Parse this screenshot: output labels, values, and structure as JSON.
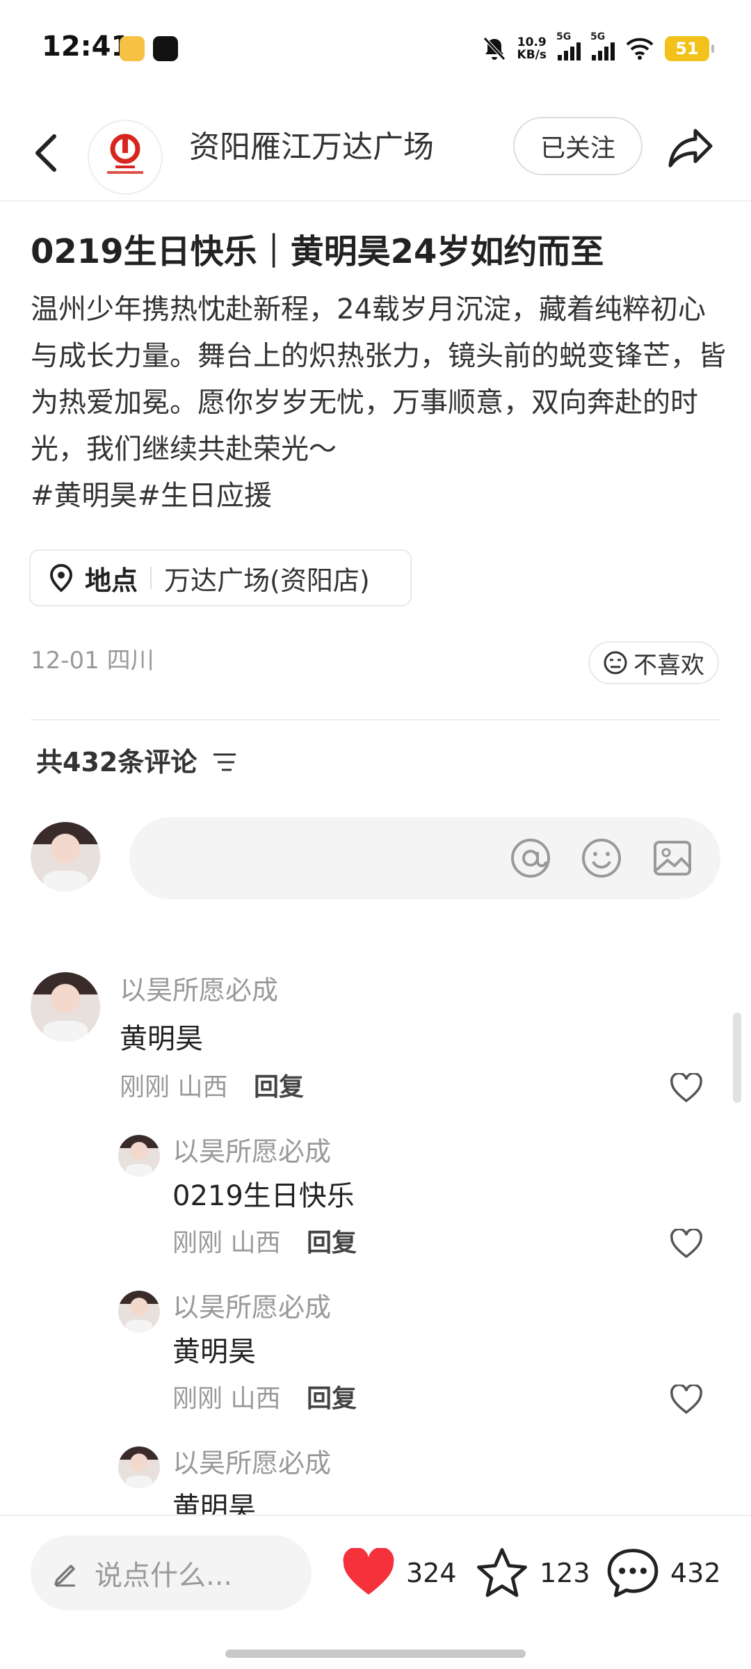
{
  "status_bar": {
    "time": "12:41",
    "speed_value": "10.9",
    "speed_unit": "KB/s",
    "network_1": "5G",
    "network_2": "5G",
    "battery": "51",
    "icons": [
      "weibo-app-icon",
      "douyin-app-icon",
      "mute-bell-icon",
      "signal-icon",
      "wifi-icon",
      "battery-icon"
    ]
  },
  "header": {
    "account_name": "资阳雁江万达广场",
    "follow_label": "已关注"
  },
  "post": {
    "title": "0219生日快乐｜黄明昊24岁如约而至",
    "body": "温州少年携热忱赴新程，24载岁月沉淀，藏着纯粹初心与成长力量。舞台上的炽热张力，镜头前的蜕变锋芒，皆为热爱加冕。愿你岁岁无忧，万事顺意，双向奔赴的时光，我们继续共赴荣光～",
    "hashtags": "#黄明昊#生日应援",
    "location_label": "地点",
    "location_name": "万达广场(资阳店)",
    "date_region": "12-01 四川",
    "dislike_label": "不喜欢"
  },
  "comments_section": {
    "count_label": "共432条评论"
  },
  "comments": [
    {
      "user": "以昊所愿必成",
      "text": "黄明昊",
      "time": "刚刚",
      "region": "山西",
      "reply_label": "回复"
    },
    {
      "user": "以昊所愿必成",
      "text": "0219生日快乐",
      "time": "刚刚",
      "region": "山西",
      "reply_label": "回复"
    },
    {
      "user": "以昊所愿必成",
      "text": "黄明昊",
      "time": "刚刚",
      "region": "山西",
      "reply_label": "回复"
    },
    {
      "user": "以昊所愿必成",
      "text": "黄明昊"
    }
  ],
  "bottom_bar": {
    "compose_placeholder": "说点什么...",
    "likes": "324",
    "favorites": "123",
    "comments": "432",
    "like_color": "#f5323c"
  },
  "colors": {
    "brand_red": "#d7261e",
    "battery": "#f2c21b"
  }
}
